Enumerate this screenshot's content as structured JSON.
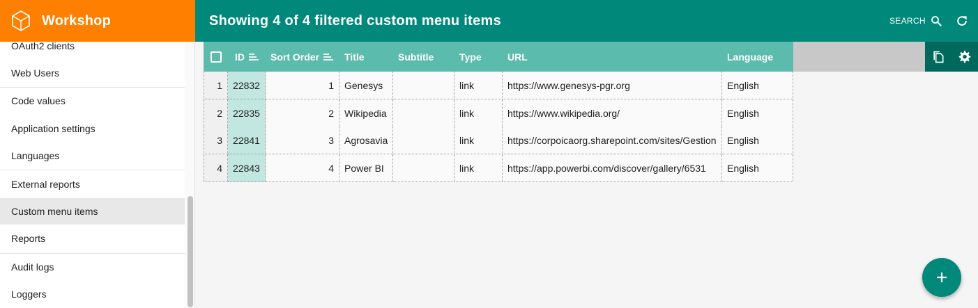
{
  "app": {
    "name": "Workshop"
  },
  "header": {
    "title": "Showing 4 of 4 filtered custom menu items",
    "search_label": "SEARCH"
  },
  "sidebar": {
    "items": [
      {
        "label": "OAuth2 clients"
      },
      {
        "label": "Web Users"
      },
      {
        "label": "Code values"
      },
      {
        "label": "Application settings"
      },
      {
        "label": "Languages"
      },
      {
        "label": "External reports"
      },
      {
        "label": "Custom menu items"
      },
      {
        "label": "Reports"
      },
      {
        "label": "Audit logs"
      },
      {
        "label": "Loggers"
      }
    ],
    "active_item": "Custom menu items"
  },
  "table": {
    "columns": [
      "ID",
      "Sort Order",
      "Title",
      "Subtitle",
      "Type",
      "URL",
      "Language"
    ],
    "rows": [
      {
        "rn": "1",
        "id": "22832",
        "sort": "1",
        "title": "Genesys",
        "subtitle": "",
        "type": "link",
        "url": "https://www.genesys-pgr.org",
        "lang": "English"
      },
      {
        "rn": "2",
        "id": "22835",
        "sort": "2",
        "title": "Wikipedia",
        "subtitle": "",
        "type": "link",
        "url": "https://www.wikipedia.org/",
        "lang": "English"
      },
      {
        "rn": "3",
        "id": "22841",
        "sort": "3",
        "title": "Agrosavia",
        "subtitle": "",
        "type": "link",
        "url": "https://corpoicaorg.sharepoint.com/sites/Gestion",
        "lang": "English"
      },
      {
        "rn": "4",
        "id": "22843",
        "sort": "4",
        "title": "Power BI",
        "subtitle": "",
        "type": "link",
        "url": "https://app.powerbi.com/discover/gallery/6531",
        "lang": "English"
      }
    ]
  },
  "colors": {
    "brand": "#ff7f00",
    "header": "#00897b",
    "table_header": "#5bbbad",
    "tools": "#00695c",
    "id_cell": "#c2e6e0"
  },
  "icons": [
    "workshop-logo-icon",
    "search-icon",
    "refresh-icon",
    "checkbox-icon",
    "sort-icon",
    "copy-icon",
    "gear-icon",
    "plus-icon"
  ]
}
